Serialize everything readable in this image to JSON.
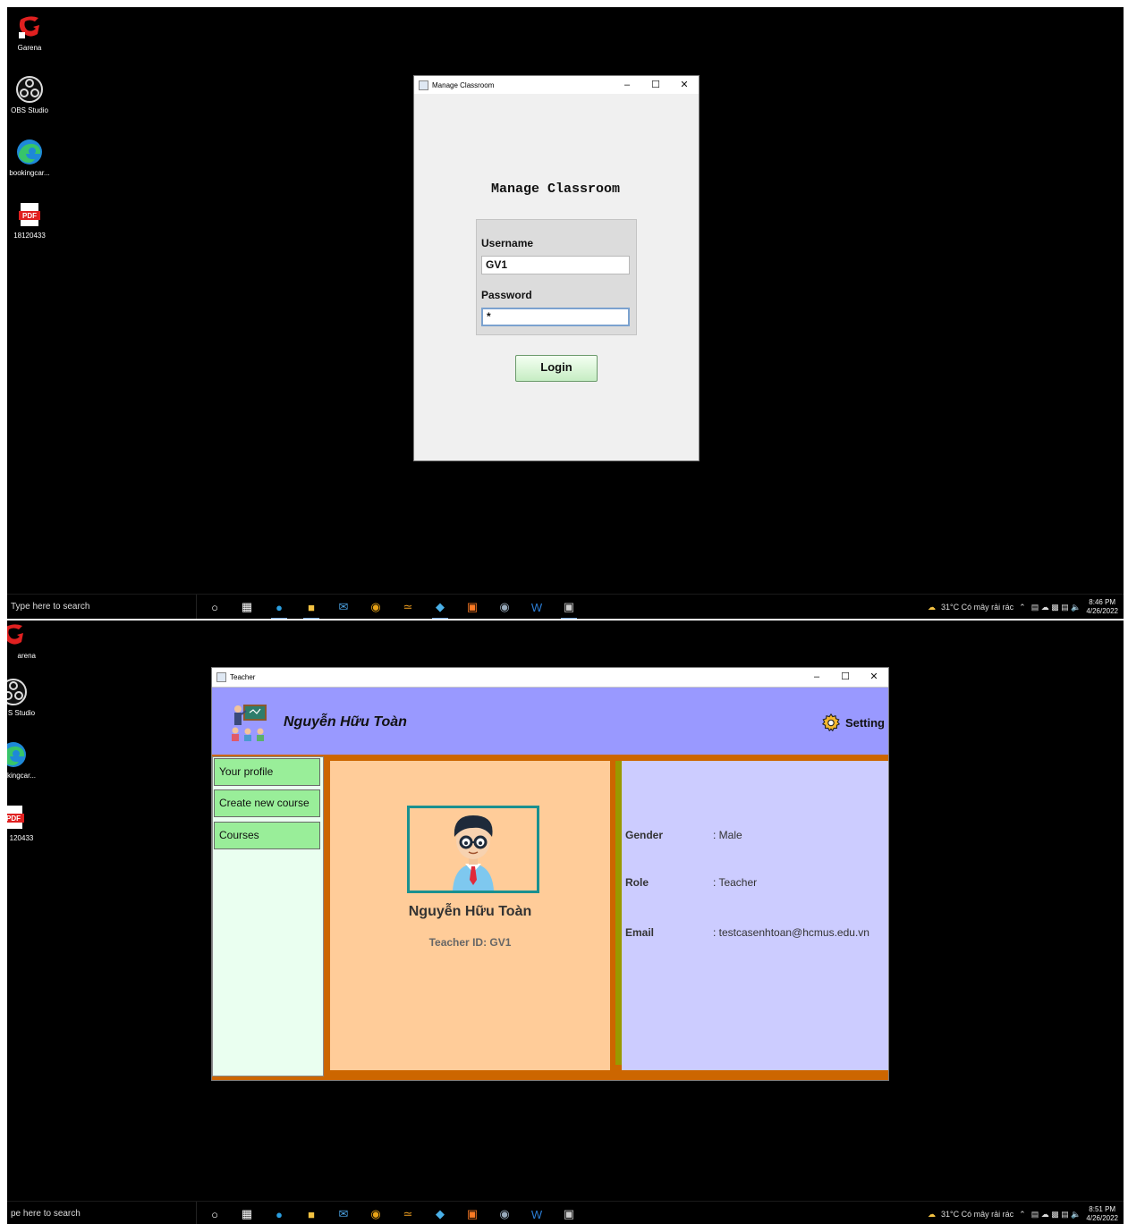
{
  "screen1": {
    "desktop_icons": [
      {
        "label": "Garena",
        "icon": "garena-icon"
      },
      {
        "label": "OBS Studio",
        "icon": "obs-icon"
      },
      {
        "label": "bookingcar...",
        "icon": "edge-icon"
      },
      {
        "label": "18120433",
        "icon": "pdf-icon"
      }
    ],
    "login_window": {
      "title": "Manage Classroom",
      "heading": "Manage Classroom",
      "username_label": "Username",
      "username_value": "GV1",
      "password_label": "Password",
      "password_value": "*",
      "login_button": "Login"
    },
    "taskbar": {
      "search_placeholder": "Type here to search",
      "weather": "31°C  Có mây rải rác",
      "time": "8:46 PM",
      "date": "4/26/2022"
    }
  },
  "screen2": {
    "desktop_icons": [
      {
        "label": "arena",
        "icon": "garena-icon"
      },
      {
        "label": "S Studio",
        "icon": "obs-icon"
      },
      {
        "label": "kingcar...",
        "icon": "edge-icon"
      },
      {
        "label": "120433",
        "icon": "pdf-icon"
      }
    ],
    "teacher_window": {
      "title": "Teacher",
      "header_name": "Nguyễn Hữu Toàn",
      "setting_label": "Setting",
      "sidebar": [
        "Your profile",
        "Create new course",
        "Courses"
      ],
      "profile": {
        "full_name": "Nguyễn Hữu Toàn",
        "teacher_id": "Teacher ID: GV1",
        "gender_label": "Gender",
        "gender_value": ": Male",
        "role_label": "Role",
        "role_value": ": Teacher",
        "email_label": "Email",
        "email_value": ": testcasenhtoan@hcmus.edu.vn"
      }
    },
    "taskbar": {
      "search_placeholder": "pe here to search",
      "weather": "31°C  Có mây rải rác",
      "time": "8:51 PM",
      "date": "4/26/2022"
    }
  },
  "colors": {
    "header": "#9999ff",
    "sidebar_item": "#99ee99",
    "sidebar_bg": "#eafff0",
    "profile_left": "#ffcc99",
    "profile_right": "#ccccff",
    "border_orange": "#cc6600",
    "divider": "#999900"
  }
}
